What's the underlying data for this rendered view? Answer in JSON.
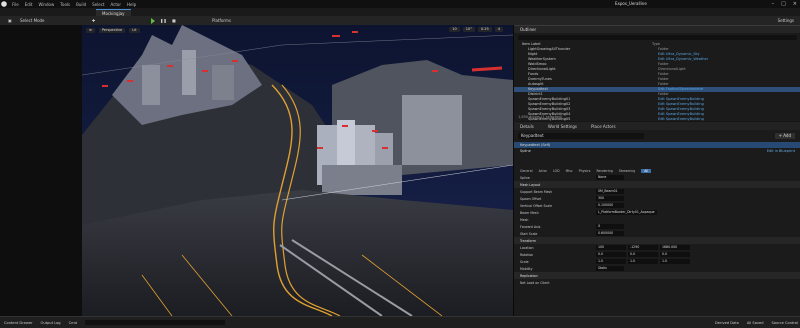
{
  "window": {
    "title": "Expos_Ueralline",
    "menu": [
      "File",
      "Edit",
      "Window",
      "Tools",
      "Build",
      "Select",
      "Actor",
      "Help"
    ]
  },
  "tab": {
    "label": "Mockingjay"
  },
  "toolbar": {
    "select_mode": "Select Mode",
    "platforms": "Platforms",
    "settings": "Settings"
  },
  "viewport": {
    "perspective": "Perspective",
    "lit": "Lit",
    "grid_snap": "10",
    "rotation_snap": "10°",
    "scale_snap": "0.25",
    "camera_speed": "4"
  },
  "outliner": {
    "tab": "Outliner",
    "columns": {
      "label": "Item Label",
      "type": "Type"
    },
    "rows": [
      {
        "label": "Item Label",
        "type": "Type",
        "plain": true,
        "sel": false
      },
      {
        "label": "LightGrowingAllThunder",
        "type": "Folder",
        "plain": true,
        "sel": false
      },
      {
        "label": "Night",
        "type": "Edit Ultra_Dynamic_Sky",
        "plain": false,
        "sel": false
      },
      {
        "label": "WeatherSystem",
        "type": "Edit Ultra_Dynamic_Weather",
        "plain": false,
        "sel": false
      },
      {
        "label": "WoldSmoo",
        "type": "Folder",
        "plain": true,
        "sel": false
      },
      {
        "label": "DirectionalLight",
        "type": "DirectionalLight",
        "plain": true,
        "sel": false
      },
      {
        "label": "Funds",
        "type": "Folder",
        "plain": true,
        "sel": false
      },
      {
        "label": "DummyTunes",
        "type": "Folder",
        "plain": true,
        "sel": false
      },
      {
        "label": "Autosplit",
        "type": "Folder",
        "plain": true,
        "sel": false
      },
      {
        "label": "Keypadtext",
        "type": "Edit FootballSpeedometre",
        "plain": false,
        "sel": true
      },
      {
        "label": "District1",
        "type": "Folder",
        "plain": true,
        "sel": false
      },
      {
        "label": "SpawnEnemyBuilding01",
        "type": "Edit SpawnEnemyBuilding",
        "plain": false,
        "sel": false
      },
      {
        "label": "SpawnEnemyBuilding02",
        "type": "Edit SpawnEnemyBuilding",
        "plain": false,
        "sel": false
      },
      {
        "label": "SpawnEnemyBuilding03",
        "type": "Edit SpawnEnemyBuilding",
        "plain": false,
        "sel": false
      },
      {
        "label": "SpawnEnemyBuilding04",
        "type": "Edit SpawnEnemyBuilding",
        "plain": false,
        "sel": false
      },
      {
        "label": "SpawnEnemyBuilding05",
        "type": "Edit SpawnEnemyBuilding",
        "plain": false,
        "sel": false
      },
      {
        "label": "SpawnEnemyBuilding06",
        "type": "Edit SpawnEnemyBuilding",
        "plain": false,
        "sel": false
      }
    ],
    "footer": "1,650 actors (1 selected)"
  },
  "details": {
    "tabs": [
      "Details",
      "World Settings",
      "Place Actors"
    ],
    "actor_name": "Keypadtext",
    "add_label": "+ Add",
    "components": [
      {
        "label": "Keypadtext (Self)",
        "bp": "",
        "sel": true
      },
      {
        "label": "Spline",
        "bp": "Edit in Blueprint",
        "sel": false
      }
    ],
    "filters": [
      "General",
      "Actor",
      "LOD",
      "Misc",
      "Physics",
      "Rendering",
      "Streaming",
      "All"
    ],
    "active_filter": "All",
    "props": [
      {
        "k": "Spline",
        "v": "None",
        "section": false
      },
      {
        "k": "Mesh Layout",
        "v": "",
        "section": true
      },
      {
        "k": "Support Beam Mesh",
        "v": "SM_Beam01",
        "section": false
      },
      {
        "k": "Spawn Offset",
        "v": "300",
        "section": false
      },
      {
        "k": "Vertical Offset Scale",
        "v": "0.100000",
        "section": false
      },
      {
        "k": "Beam Mesh",
        "v": "L_PlatformBorder_Dirty01_Aopaque",
        "section": false
      },
      {
        "k": "Mesh",
        "v": "",
        "section": false
      },
      {
        "k": "Forward Axis",
        "v": "X",
        "section": false
      },
      {
        "k": "Start Scale",
        "v": "0.600000",
        "section": false
      },
      {
        "k": "Transform",
        "v": "",
        "section": true
      },
      {
        "k": "Location",
        "v": "",
        "section": false,
        "vec": [
          "100",
          "-1290",
          "1680.000"
        ]
      },
      {
        "k": "Rotation",
        "v": "",
        "section": false,
        "vec": [
          "0.0",
          "0.0",
          "0.0"
        ]
      },
      {
        "k": "Scale",
        "v": "",
        "section": false,
        "vec": [
          "1.0",
          "1.0",
          "1.0"
        ]
      },
      {
        "k": "Mobility",
        "v": "Static",
        "section": false
      },
      {
        "k": "Replication",
        "v": "",
        "section": true
      },
      {
        "k": "Net Load on Client",
        "v": "",
        "section": false
      }
    ]
  },
  "status": {
    "content_drawer": "Content Drawer",
    "output_log": "Output Log",
    "cmd": "Cmd",
    "derived_data": "Derived Data",
    "all_saved": "All Saved",
    "source_control": "Source Control"
  },
  "colors": {
    "accent": "#3b6ea5",
    "play": "#5fbf3e",
    "spline": "#e0a030",
    "marker": "#d83030"
  }
}
